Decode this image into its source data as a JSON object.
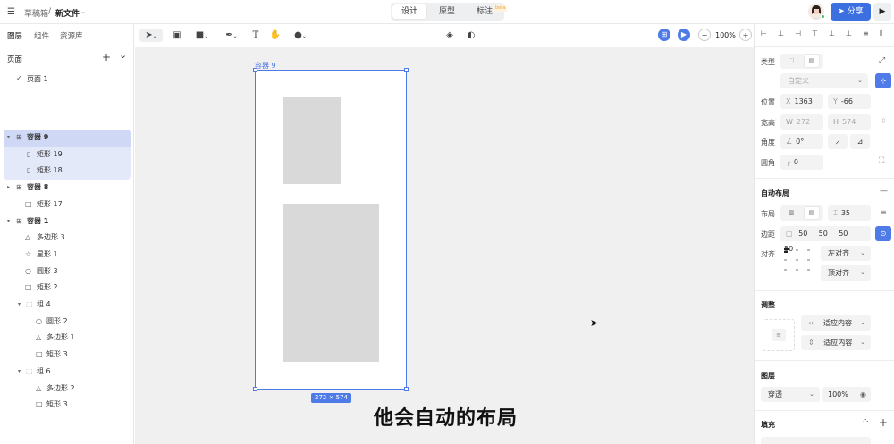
{
  "topbar": {
    "menu_icon": "menu-icon",
    "breadcrumb": [
      "草稿箱",
      "/",
      "新文件"
    ],
    "mode_tabs": [
      "设计",
      "原型",
      "标注"
    ],
    "beta_badge": "beta",
    "share_label": "分享",
    "play_icon": "▶"
  },
  "left": {
    "tabs": [
      "图层",
      "组件",
      "资源库"
    ],
    "pages_title": "页面",
    "add_icon": "+",
    "collapse_icon": "⌄",
    "page_check": "✓",
    "page_name": "页面 1",
    "layers": [
      {
        "label": "容器 9",
        "icon": "frame",
        "caret": "▾"
      },
      {
        "label": "矩形 19",
        "icon": "rect-tall",
        "caret": ""
      },
      {
        "label": "矩形 18",
        "icon": "rect-tall",
        "caret": ""
      },
      {
        "label": "容器 8",
        "icon": "frame",
        "caret": "▸"
      },
      {
        "label": "矩形 17",
        "icon": "rect",
        "caret": ""
      },
      {
        "label": "容器 1",
        "icon": "frame",
        "caret": "▾"
      },
      {
        "label": "多边形 3",
        "icon": "triangle",
        "caret": ""
      },
      {
        "label": "星形 1",
        "icon": "star",
        "caret": ""
      },
      {
        "label": "圆形 3",
        "icon": "circle",
        "caret": ""
      },
      {
        "label": "矩形 2",
        "icon": "rect",
        "caret": ""
      },
      {
        "label": "组 4",
        "icon": "group",
        "caret": "▾"
      },
      {
        "label": "圆形 2",
        "icon": "circle",
        "caret": ""
      },
      {
        "label": "多边形 1",
        "icon": "triangle",
        "caret": ""
      },
      {
        "label": "矩形 3",
        "icon": "rect",
        "caret": ""
      },
      {
        "label": "组 6",
        "icon": "group",
        "caret": "▾"
      },
      {
        "label": "多边形 2",
        "icon": "triangle",
        "caret": ""
      },
      {
        "label": "矩形 3",
        "icon": "rect",
        "caret": ""
      }
    ]
  },
  "toolbar": {
    "zoom": "100%",
    "zoom_minus": "−",
    "zoom_plus": "+"
  },
  "canvas": {
    "frame_label": "容器 9",
    "size_badge": "272 × 574",
    "subtitle": "他会自动的布局",
    "help": "?"
  },
  "right": {
    "type_label": "类型",
    "preset_placeholder": "自定义",
    "position_label": "位置",
    "x_prefix": "X",
    "x_value": "1363",
    "y_prefix": "Y",
    "y_value": "-66",
    "size_label": "宽高",
    "w_prefix": "W",
    "w_value": "272",
    "h_prefix": "H",
    "h_value": "574",
    "angle_label": "角度",
    "angle_value": "0°",
    "radius_label": "圆角",
    "radius_value": "0",
    "auto_layout_title": "自动布局",
    "auto_layout_remove": "—",
    "layout_label": "布局",
    "gap_value": "35",
    "padding_label": "边距",
    "padding_values": [
      "50",
      "50",
      "50",
      "50"
    ],
    "align_label": "对齐",
    "align_h": "左对齐",
    "align_v": "顶对齐",
    "resize_title": "调整",
    "resize_w": "适应内容",
    "resize_h": "适应内容",
    "layer_title": "图层",
    "blend_mode": "穿透",
    "opacity": "100%",
    "fill_title": "填充",
    "fill_add": "+"
  },
  "colors": {
    "accent": "#4f7be8",
    "share": "#3c6fe0",
    "selection_bg": "#cfd8f5"
  }
}
